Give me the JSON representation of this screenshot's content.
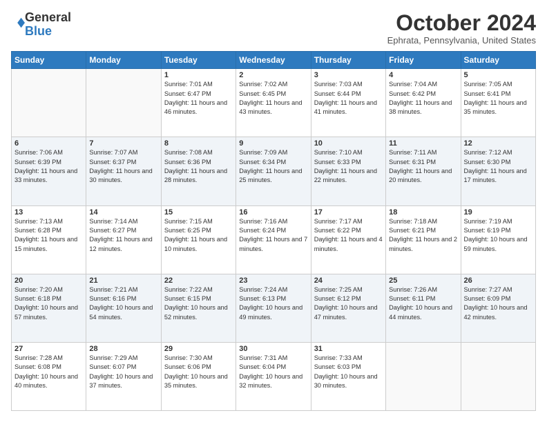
{
  "header": {
    "logo_general": "General",
    "logo_blue": "Blue",
    "month_title": "October 2024",
    "location": "Ephrata, Pennsylvania, United States"
  },
  "weekdays": [
    "Sunday",
    "Monday",
    "Tuesday",
    "Wednesday",
    "Thursday",
    "Friday",
    "Saturday"
  ],
  "weeks": [
    [
      {
        "day": "",
        "info": ""
      },
      {
        "day": "",
        "info": ""
      },
      {
        "day": "1",
        "info": "Sunrise: 7:01 AM\nSunset: 6:47 PM\nDaylight: 11 hours and 46 minutes."
      },
      {
        "day": "2",
        "info": "Sunrise: 7:02 AM\nSunset: 6:45 PM\nDaylight: 11 hours and 43 minutes."
      },
      {
        "day": "3",
        "info": "Sunrise: 7:03 AM\nSunset: 6:44 PM\nDaylight: 11 hours and 41 minutes."
      },
      {
        "day": "4",
        "info": "Sunrise: 7:04 AM\nSunset: 6:42 PM\nDaylight: 11 hours and 38 minutes."
      },
      {
        "day": "5",
        "info": "Sunrise: 7:05 AM\nSunset: 6:41 PM\nDaylight: 11 hours and 35 minutes."
      }
    ],
    [
      {
        "day": "6",
        "info": "Sunrise: 7:06 AM\nSunset: 6:39 PM\nDaylight: 11 hours and 33 minutes."
      },
      {
        "day": "7",
        "info": "Sunrise: 7:07 AM\nSunset: 6:37 PM\nDaylight: 11 hours and 30 minutes."
      },
      {
        "day": "8",
        "info": "Sunrise: 7:08 AM\nSunset: 6:36 PM\nDaylight: 11 hours and 28 minutes."
      },
      {
        "day": "9",
        "info": "Sunrise: 7:09 AM\nSunset: 6:34 PM\nDaylight: 11 hours and 25 minutes."
      },
      {
        "day": "10",
        "info": "Sunrise: 7:10 AM\nSunset: 6:33 PM\nDaylight: 11 hours and 22 minutes."
      },
      {
        "day": "11",
        "info": "Sunrise: 7:11 AM\nSunset: 6:31 PM\nDaylight: 11 hours and 20 minutes."
      },
      {
        "day": "12",
        "info": "Sunrise: 7:12 AM\nSunset: 6:30 PM\nDaylight: 11 hours and 17 minutes."
      }
    ],
    [
      {
        "day": "13",
        "info": "Sunrise: 7:13 AM\nSunset: 6:28 PM\nDaylight: 11 hours and 15 minutes."
      },
      {
        "day": "14",
        "info": "Sunrise: 7:14 AM\nSunset: 6:27 PM\nDaylight: 11 hours and 12 minutes."
      },
      {
        "day": "15",
        "info": "Sunrise: 7:15 AM\nSunset: 6:25 PM\nDaylight: 11 hours and 10 minutes."
      },
      {
        "day": "16",
        "info": "Sunrise: 7:16 AM\nSunset: 6:24 PM\nDaylight: 11 hours and 7 minutes."
      },
      {
        "day": "17",
        "info": "Sunrise: 7:17 AM\nSunset: 6:22 PM\nDaylight: 11 hours and 4 minutes."
      },
      {
        "day": "18",
        "info": "Sunrise: 7:18 AM\nSunset: 6:21 PM\nDaylight: 11 hours and 2 minutes."
      },
      {
        "day": "19",
        "info": "Sunrise: 7:19 AM\nSunset: 6:19 PM\nDaylight: 10 hours and 59 minutes."
      }
    ],
    [
      {
        "day": "20",
        "info": "Sunrise: 7:20 AM\nSunset: 6:18 PM\nDaylight: 10 hours and 57 minutes."
      },
      {
        "day": "21",
        "info": "Sunrise: 7:21 AM\nSunset: 6:16 PM\nDaylight: 10 hours and 54 minutes."
      },
      {
        "day": "22",
        "info": "Sunrise: 7:22 AM\nSunset: 6:15 PM\nDaylight: 10 hours and 52 minutes."
      },
      {
        "day": "23",
        "info": "Sunrise: 7:24 AM\nSunset: 6:13 PM\nDaylight: 10 hours and 49 minutes."
      },
      {
        "day": "24",
        "info": "Sunrise: 7:25 AM\nSunset: 6:12 PM\nDaylight: 10 hours and 47 minutes."
      },
      {
        "day": "25",
        "info": "Sunrise: 7:26 AM\nSunset: 6:11 PM\nDaylight: 10 hours and 44 minutes."
      },
      {
        "day": "26",
        "info": "Sunrise: 7:27 AM\nSunset: 6:09 PM\nDaylight: 10 hours and 42 minutes."
      }
    ],
    [
      {
        "day": "27",
        "info": "Sunrise: 7:28 AM\nSunset: 6:08 PM\nDaylight: 10 hours and 40 minutes."
      },
      {
        "day": "28",
        "info": "Sunrise: 7:29 AM\nSunset: 6:07 PM\nDaylight: 10 hours and 37 minutes."
      },
      {
        "day": "29",
        "info": "Sunrise: 7:30 AM\nSunset: 6:06 PM\nDaylight: 10 hours and 35 minutes."
      },
      {
        "day": "30",
        "info": "Sunrise: 7:31 AM\nSunset: 6:04 PM\nDaylight: 10 hours and 32 minutes."
      },
      {
        "day": "31",
        "info": "Sunrise: 7:33 AM\nSunset: 6:03 PM\nDaylight: 10 hours and 30 minutes."
      },
      {
        "day": "",
        "info": ""
      },
      {
        "day": "",
        "info": ""
      }
    ]
  ]
}
